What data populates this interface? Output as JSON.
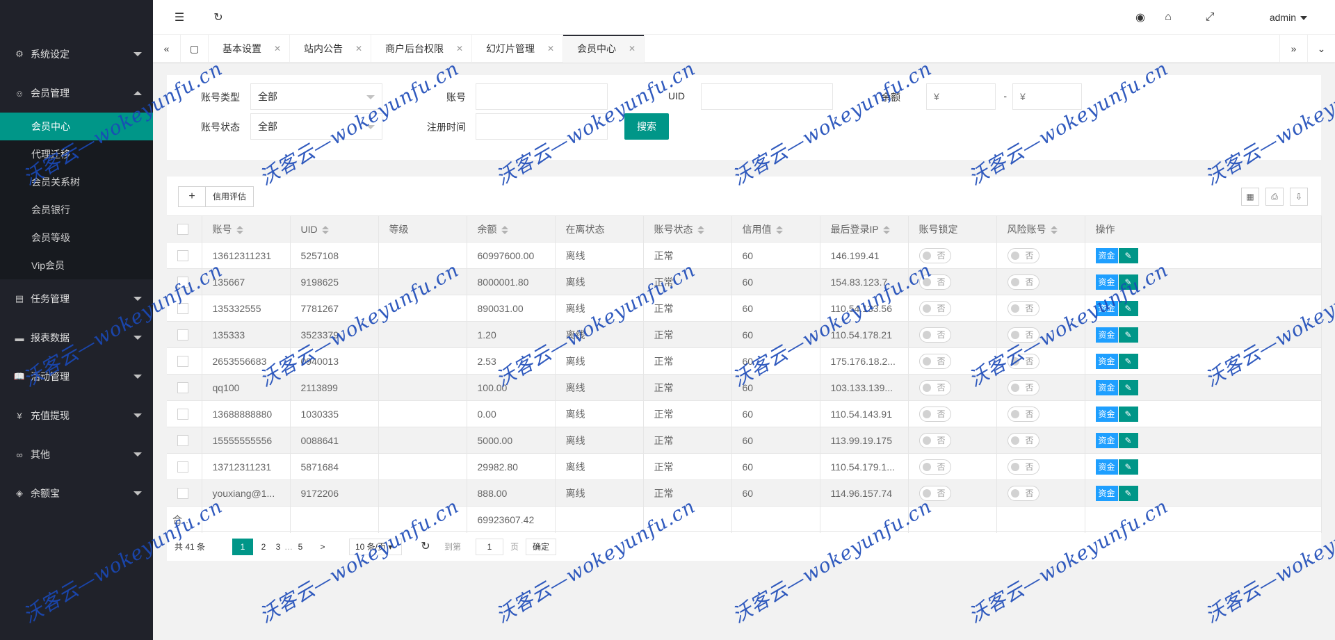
{
  "sidebar": {
    "groups": [
      {
        "label": "系统设定",
        "icon": "gear-icon"
      },
      {
        "label": "会员管理",
        "icon": "user-icon",
        "items": [
          "会员中心",
          "代理迁移",
          "会员关系树",
          "会员银行",
          "会员等级",
          "Vip会员"
        ]
      },
      {
        "label": "任务管理",
        "icon": "task-icon"
      },
      {
        "label": "报表数据",
        "icon": "report-icon"
      },
      {
        "label": "活动管理",
        "icon": "book-icon"
      },
      {
        "label": "充值提现",
        "icon": "yuan-icon"
      },
      {
        "label": "其他",
        "icon": "link-icon"
      },
      {
        "label": "余额宝",
        "icon": "wallet-icon"
      }
    ]
  },
  "topbar": {
    "user": "admin"
  },
  "tabs": [
    "基本设置",
    "站内公告",
    "商户后台权限",
    "幻灯片管理",
    "会员中心"
  ],
  "form": {
    "account_type_label": "账号类型",
    "account_type_value": "全部",
    "account_label": "账号",
    "uid_label": "UID",
    "balance_label": "余额",
    "balance_min_placeholder": "¥",
    "balance_sep": "-",
    "balance_max_placeholder": "¥",
    "status_label": "账号状态",
    "status_value": "全部",
    "reg_time_label": "注册时间",
    "search_label": "搜索"
  },
  "toolbar": {
    "add": "+",
    "credit": "信用评估"
  },
  "table": {
    "headers": [
      "账号",
      "UID",
      "等级",
      "余额",
      "在离状态",
      "账号状态",
      "信用值",
      "最后登录IP",
      "账号锁定",
      "风险账号",
      "操作"
    ],
    "rows": [
      [
        "13612311231",
        "5257108",
        "",
        "60997600.00",
        "离线",
        "正常",
        "60",
        "146.199.41"
      ],
      [
        "135667",
        "9198625",
        "",
        "8000001.80",
        "离线",
        "正常",
        "60",
        "154.83.123.7"
      ],
      [
        "135332555",
        "7781267",
        "",
        "890031.00",
        "离线",
        "正常",
        "60",
        "110.54.133.56"
      ],
      [
        "135333",
        "3523379",
        "",
        "1.20",
        "离线",
        "正常",
        "60",
        "110.54.178.21"
      ],
      [
        "2653556683",
        "0940013",
        "",
        "2.53",
        "离线",
        "正常",
        "60",
        "175.176.18.2..."
      ],
      [
        "qq100",
        "2113899",
        "",
        "100.00",
        "离线",
        "正常",
        "60",
        "103.133.139..."
      ],
      [
        "13688888880",
        "1030335",
        "",
        "0.00",
        "离线",
        "正常",
        "60",
        "110.54.143.91"
      ],
      [
        "15555555556",
        "0088641",
        "",
        "5000.00",
        "离线",
        "正常",
        "60",
        "113.99.19.175"
      ],
      [
        "13712311231",
        "5871684",
        "",
        "29982.80",
        "离线",
        "正常",
        "60",
        "110.54.179.1..."
      ],
      [
        "youxiang@1...",
        "9172206",
        "",
        "888.00",
        "离线",
        "正常",
        "60",
        "114.96.157.74"
      ]
    ],
    "switch_text": "否",
    "op_money": "资金",
    "op_edit": "✎",
    "total_label": "合计",
    "total_value": "69923607.42"
  },
  "pager": {
    "total": "共 41 条",
    "pages": [
      "1",
      "2",
      "3",
      "…",
      "5"
    ],
    "next": ">",
    "per_page": "10 条/页",
    "goto_label": "到第",
    "goto_value": "1",
    "page_unit": "页",
    "confirm": "确定"
  },
  "watermark": "沃客云—wokeyunfu.cn"
}
